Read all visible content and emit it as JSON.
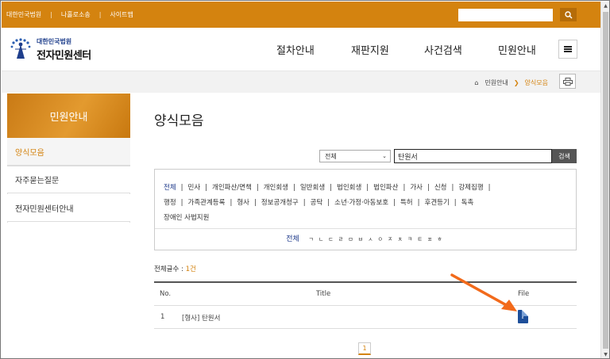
{
  "topbar": {
    "links": [
      "대한민국법원",
      "나홀로소송",
      "사이트맵"
    ],
    "separator": "|",
    "search_icon": "search-icon"
  },
  "header": {
    "logo_line1": "대한민국법원",
    "logo_line2": "전자민원센터",
    "nav": [
      "절차안내",
      "재판지원",
      "사건검색",
      "민원안내"
    ],
    "menu_icon": "hamburger-icon"
  },
  "breadcrumb": {
    "home_icon": "home-icon",
    "items": [
      "민원안내",
      "양식모음"
    ],
    "arrow": "❯"
  },
  "sidebar": {
    "title": "민원안내",
    "items": [
      {
        "label": "양식모음",
        "active": true
      },
      {
        "label": "자주묻는질문",
        "active": false
      },
      {
        "label": "전자민원센터안내",
        "active": false
      }
    ]
  },
  "main": {
    "title": "양식모음",
    "search": {
      "select_value": "전체",
      "keyword": "탄원서",
      "button": "검색"
    },
    "categories": [
      "전체",
      "민사",
      "개인파산/면책",
      "개인회생",
      "일반회생",
      "법인회생",
      "법인파산",
      "가사",
      "신청",
      "강제집행",
      "행정",
      "가족관계등록",
      "형사",
      "정보공개청구",
      "공탁",
      "소년·가정·아동보호",
      "특허",
      "후견등기",
      "독촉",
      "장애인 사법지원"
    ],
    "initials_all": "전체",
    "initials": [
      "ㄱ",
      "ㄴ",
      "ㄷ",
      "ㄹ",
      "ㅁ",
      "ㅂ",
      "ㅅ",
      "ㅇ",
      "ㅈ",
      "ㅊ",
      "ㅋ",
      "ㅌ",
      "ㅍ",
      "ㅎ"
    ],
    "count_label": "전체글수 : ",
    "count_value": "1건",
    "table": {
      "headers": [
        "No.",
        "Title",
        "File"
      ],
      "rows": [
        {
          "no": "1",
          "title": "[형사] 탄원서",
          "file_icon": "hwp-file-icon"
        }
      ]
    },
    "pagination": [
      "1"
    ]
  },
  "colors": {
    "brand": "#d4830f",
    "annotation_arrow": "#f26a1b",
    "active_category": "#1e3a8a"
  }
}
